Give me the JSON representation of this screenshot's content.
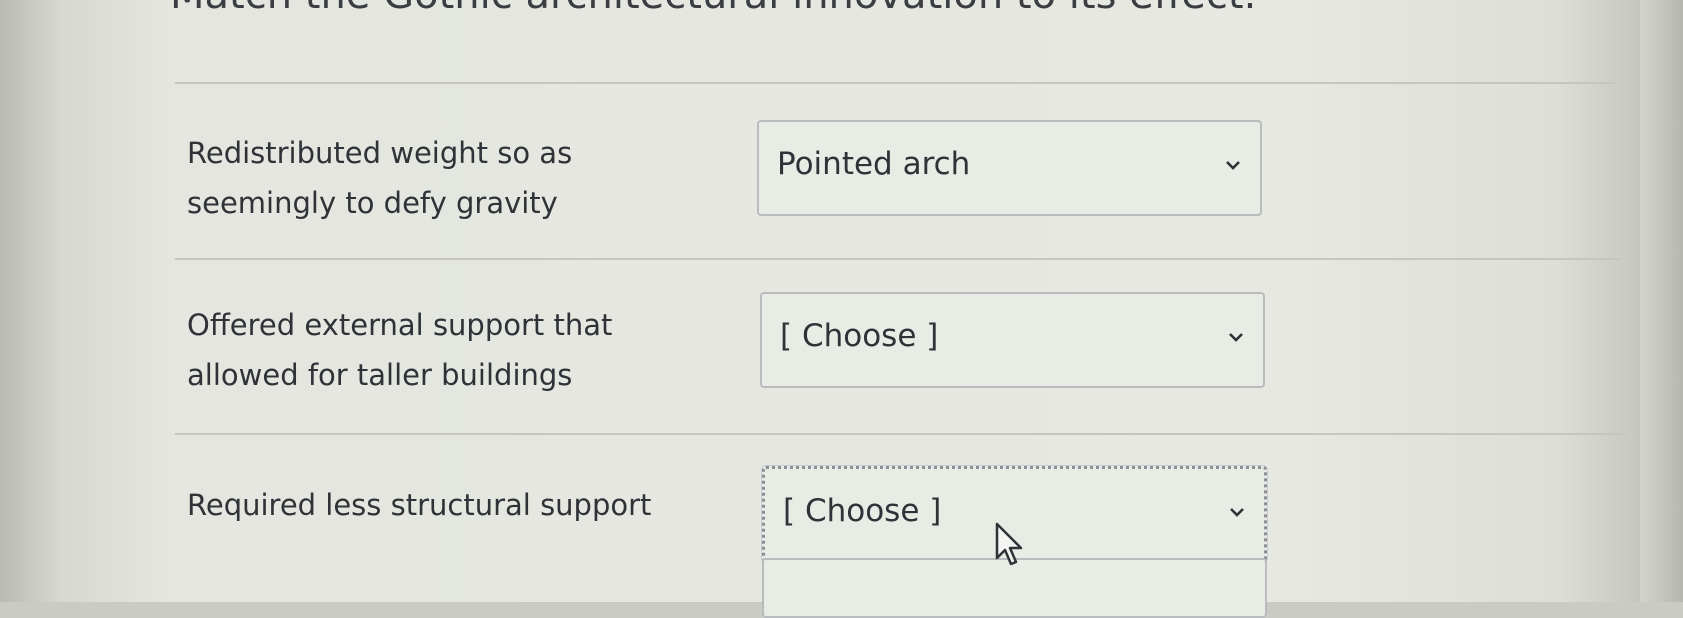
{
  "prompt": "Match the Gothic architectural innovation to its effect.",
  "rows": [
    {
      "label": "Redistributed weight so as seemingly to defy gravity",
      "selected": "Pointed arch"
    },
    {
      "label": "Offered external support that allowed for taller buildings",
      "selected": "[ Choose ]"
    },
    {
      "label": "Required less structural support",
      "selected": "[ Choose ]"
    }
  ],
  "icons": {
    "dropdown": "chevron-down-icon",
    "cursor": "mouse-pointer-icon"
  }
}
